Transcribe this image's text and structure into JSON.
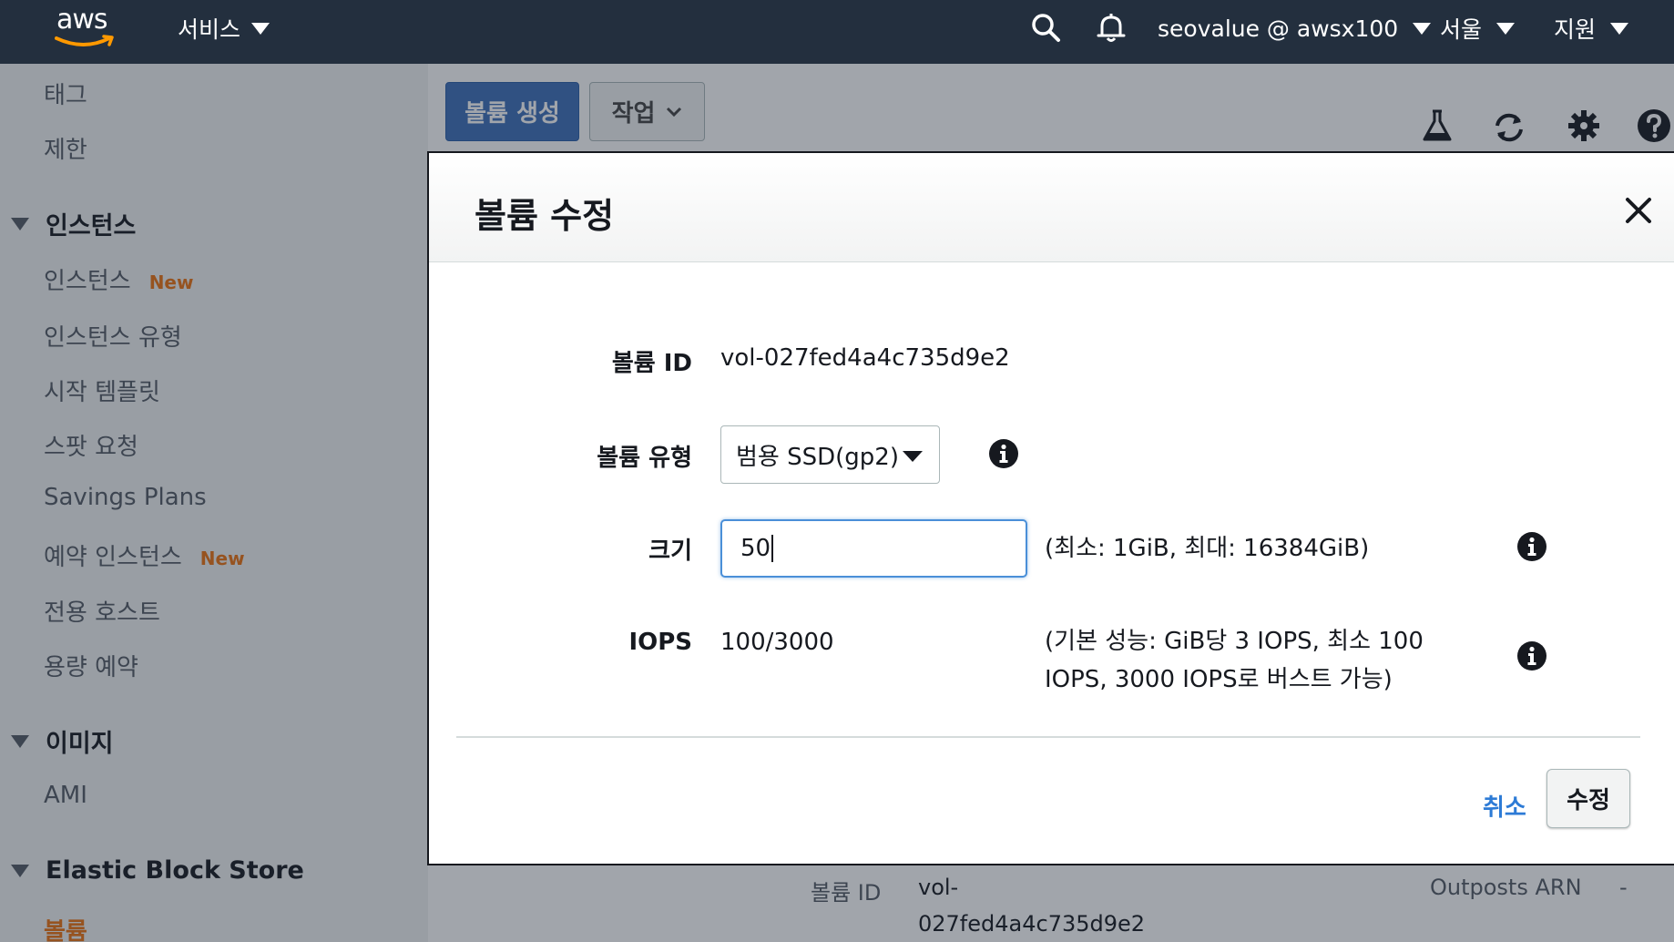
{
  "topnav": {
    "logo": "aws",
    "services": "서비스",
    "account": "seovalue @ awsx100",
    "region": "서울",
    "support": "지원"
  },
  "toolbar": {
    "create_volume": "볼륨 생성",
    "actions": "작업"
  },
  "sidebar": {
    "items_top": [
      "태그",
      "제한"
    ],
    "instances_header": "인스턴스",
    "instances_items": [
      {
        "label": "인스턴스",
        "badge": "New"
      },
      {
        "label": "인스턴스 유형",
        "badge": ""
      },
      {
        "label": "시작 템플릿",
        "badge": ""
      },
      {
        "label": "스팟 요청",
        "badge": ""
      },
      {
        "label": "Savings Plans",
        "badge": ""
      },
      {
        "label": "예약 인스턴스",
        "badge": "New"
      },
      {
        "label": "전용 호스트",
        "badge": ""
      },
      {
        "label": "용량 예약",
        "badge": ""
      }
    ],
    "images_header": "이미지",
    "images_items": [
      "AMI"
    ],
    "ebs_header": "Elastic Block Store",
    "ebs_items": [
      "볼륨"
    ]
  },
  "details": {
    "volume_id_label": "볼륨 ID",
    "volume_id_value_line1": "vol-",
    "volume_id_value_line2": "027fed4a4c735d9e2",
    "outposts_label": "Outposts ARN",
    "outposts_value": "-"
  },
  "modal": {
    "title": "볼륨 수정",
    "volume_id_label": "볼륨 ID",
    "volume_id": "vol-027fed4a4c735d9e2",
    "volume_type_label": "볼륨 유형",
    "volume_type": "범용 SSD(gp2)",
    "size_label": "크기",
    "size_value": "50",
    "size_hint": "(최소: 1GiB, 최대: 16384GiB)",
    "iops_label": "IOPS",
    "iops_value": "100/3000",
    "iops_hint_line1": "(기본 성능: GiB당 3 IOPS, 최소 100",
    "iops_hint_line2": "IOPS, 3000 IOPS로 버스트 가능)",
    "cancel": "취소",
    "submit": "수정"
  },
  "colors": {
    "nav_bg": "#232f3e",
    "primary": "#3d6fb8",
    "link": "#2d7bd6",
    "accent": "#ec7211"
  }
}
